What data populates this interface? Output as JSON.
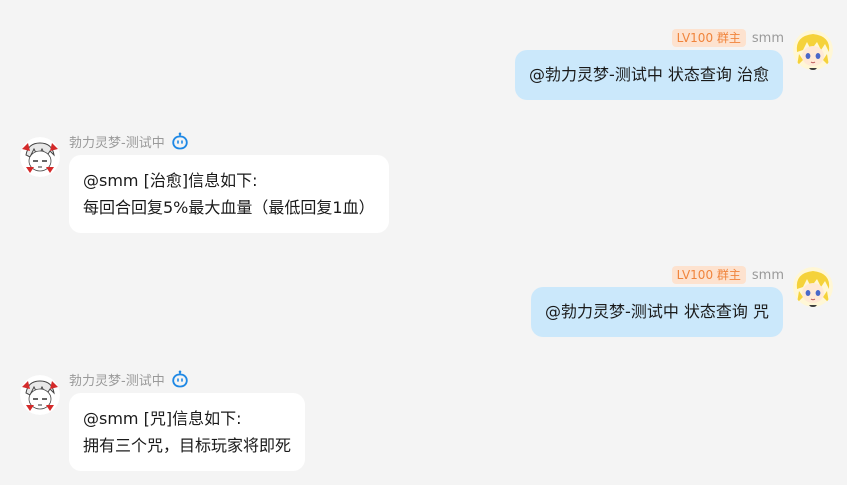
{
  "colors": {
    "background": "#f4f4f4",
    "self_bubble": "#cbe8fb",
    "bot_bubble": "#ffffff",
    "badge_bg": "#fde2cf",
    "badge_text": "#f0843c",
    "bot_icon": "#1e88e5"
  },
  "messages": [
    {
      "side": "right",
      "badge": "LV100 群主",
      "sender": "smm",
      "avatar_icon": "blonde-anime-avatar-icon",
      "text": "@勃力灵梦-测试中 状态查询 治愈"
    },
    {
      "side": "left",
      "sender": "勃力灵梦-测试中",
      "avatar_icon": "reimu-avatar-icon",
      "bot_icon": "robot-icon",
      "lines": [
        "@smm [治愈]信息如下:",
        "每回合回复5%最大血量（最低回复1血）"
      ]
    },
    {
      "side": "right",
      "badge": "LV100 群主",
      "sender": "smm",
      "avatar_icon": "blonde-anime-avatar-icon",
      "text": "@勃力灵梦-测试中 状态查询 咒"
    },
    {
      "side": "left",
      "sender": "勃力灵梦-测试中",
      "avatar_icon": "reimu-avatar-icon",
      "bot_icon": "robot-icon",
      "lines": [
        "@smm [咒]信息如下:",
        "拥有三个咒，目标玩家将即死"
      ]
    }
  ]
}
